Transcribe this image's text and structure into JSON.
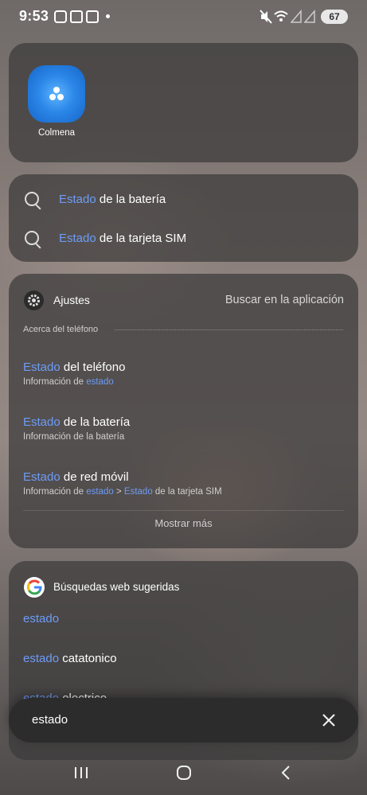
{
  "status_bar": {
    "time": "9:53",
    "battery": "67"
  },
  "app_card": {
    "app_name": "Colmena"
  },
  "suggestions": [
    {
      "highlight": "Estado",
      "rest": " de la batería"
    },
    {
      "highlight": "Estado",
      "rest": " de la tarjeta SIM"
    }
  ],
  "settings": {
    "app_name": "Ajustes",
    "search_in_app": "Buscar en la aplicación",
    "section": "Acerca del teléfono",
    "results": [
      {
        "title_hl": "Estado",
        "title_rest": " del teléfono",
        "sub_pre": "Información de ",
        "sub_hl": "estado",
        "sub_mid": "",
        "sub_hl2": "",
        "sub_post": ""
      },
      {
        "title_hl": "Estado",
        "title_rest": " de la batería",
        "sub_pre": "Información de la batería",
        "sub_hl": "",
        "sub_mid": "",
        "sub_hl2": "",
        "sub_post": ""
      },
      {
        "title_hl": "Estado",
        "title_rest": " de red móvil",
        "sub_pre": "Información de ",
        "sub_hl": "estado",
        "sub_mid": " > ",
        "sub_hl2": "Estado",
        "sub_post": " de la tarjeta SIM"
      }
    ],
    "show_more": "Mostrar más"
  },
  "web": {
    "title": "Búsquedas web sugeridas",
    "items": [
      {
        "hl": "estado",
        "rest": ""
      },
      {
        "hl": "estado",
        "rest": " catatonico"
      },
      {
        "hl": "estado",
        "rest": " electrico"
      }
    ]
  },
  "search": {
    "query": "estado"
  },
  "colors": {
    "highlight": "#6d9cf6",
    "card": "#3c3a3a",
    "app_icon": "#1f74d6"
  }
}
